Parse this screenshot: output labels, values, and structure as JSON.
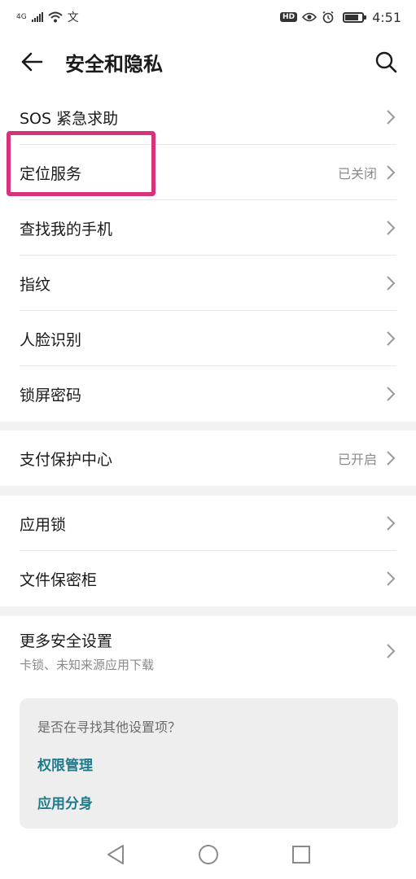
{
  "status_bar": {
    "network": "4G",
    "extra_glyph": "文",
    "hd": "HD",
    "time": "4:51",
    "battery_level": 0.8
  },
  "header": {
    "title": "安全和隐私",
    "back_icon": "arrow-left-icon",
    "search_icon": "search-icon"
  },
  "groups": [
    {
      "items": [
        {
          "label": "SOS 紧急求助",
          "value": ""
        },
        {
          "label": "定位服务",
          "value": "已关闭"
        },
        {
          "label": "查找我的手机",
          "value": ""
        },
        {
          "label": "指纹",
          "value": ""
        },
        {
          "label": "人脸识别",
          "value": ""
        },
        {
          "label": "锁屏密码",
          "value": ""
        }
      ]
    },
    {
      "items": [
        {
          "label": "支付保护中心",
          "value": "已开启"
        }
      ]
    },
    {
      "items": [
        {
          "label": "应用锁",
          "value": ""
        },
        {
          "label": "文件保密柜",
          "value": ""
        }
      ]
    },
    {
      "items": [
        {
          "label": "更多安全设置",
          "sub": "卡锁、未知来源应用下载",
          "value": ""
        }
      ]
    }
  ],
  "suggest": {
    "title": "是否在寻找其他设置项？",
    "links": [
      "权限管理",
      "应用分身"
    ]
  },
  "colors": {
    "highlight": "#d6337b",
    "link": "#1f7a8c"
  }
}
